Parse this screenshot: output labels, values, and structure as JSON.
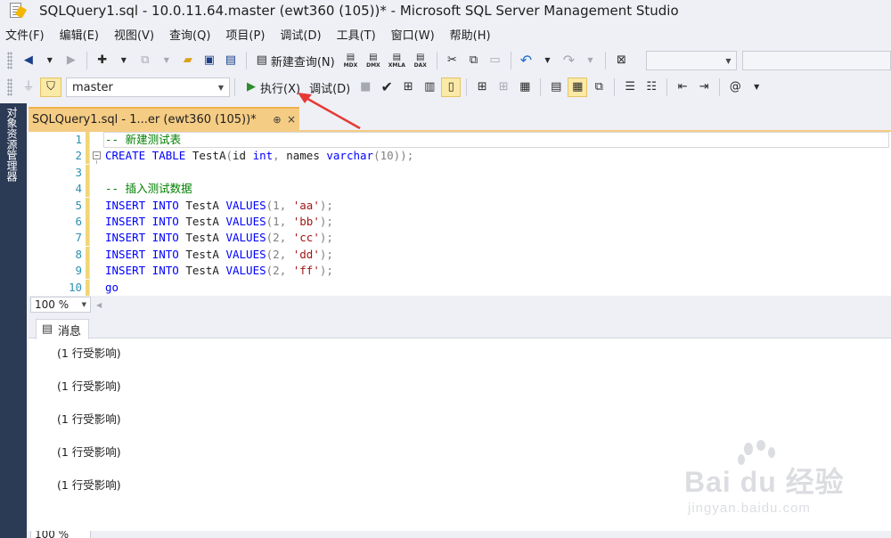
{
  "window": {
    "title": "SQLQuery1.sql - 10.0.11.64.master (ewt360 (105))* - Microsoft SQL Server Management Studio"
  },
  "menu": {
    "items": [
      "文件(F)",
      "编辑(E)",
      "视图(V)",
      "查询(Q)",
      "项目(P)",
      "调试(D)",
      "工具(T)",
      "窗口(W)",
      "帮助(H)"
    ]
  },
  "toolbar1": {
    "new_query_label": "新建查询(N)",
    "mdx_label": "MDX",
    "dmx_label": "DMX",
    "xmla_label": "XMLA",
    "dax_label": "DAX"
  },
  "toolbar2": {
    "database": "master",
    "execute_label": "执行(X)",
    "debug_label": "调试(D)"
  },
  "sidebar": {
    "label": "对象资源管理器"
  },
  "tab": {
    "title": "SQLQuery1.sql - 1...er (ewt360 (105))*",
    "pin_glyph": "⊕",
    "close_glyph": "×"
  },
  "editor": {
    "lines": [
      {
        "n": "1",
        "tokens": [
          {
            "t": "-- 新建测试表",
            "c": "cm"
          }
        ]
      },
      {
        "n": "2",
        "tokens": [
          {
            "t": "CREATE TABLE",
            "c": "kw"
          },
          {
            "t": " TestA",
            "c": ""
          },
          {
            "t": "(",
            "c": "gr"
          },
          {
            "t": "id ",
            "c": ""
          },
          {
            "t": "int",
            "c": "kw"
          },
          {
            "t": ", ",
            "c": "gr"
          },
          {
            "t": "names ",
            "c": ""
          },
          {
            "t": "varchar",
            "c": "kw"
          },
          {
            "t": "(10));",
            "c": "gr"
          }
        ]
      },
      {
        "n": "3",
        "tokens": []
      },
      {
        "n": "4",
        "tokens": [
          {
            "t": "-- 插入测试数据",
            "c": "cm"
          }
        ]
      },
      {
        "n": "5",
        "tokens": [
          {
            "t": "INSERT INTO",
            "c": "kw"
          },
          {
            "t": " TestA ",
            "c": ""
          },
          {
            "t": "VALUES",
            "c": "kw"
          },
          {
            "t": "(1, ",
            "c": "gr"
          },
          {
            "t": "'aa'",
            "c": "st"
          },
          {
            "t": ");",
            "c": "gr"
          }
        ]
      },
      {
        "n": "6",
        "tokens": [
          {
            "t": "INSERT INTO",
            "c": "kw"
          },
          {
            "t": " TestA ",
            "c": ""
          },
          {
            "t": "VALUES",
            "c": "kw"
          },
          {
            "t": "(1, ",
            "c": "gr"
          },
          {
            "t": "'bb'",
            "c": "st"
          },
          {
            "t": ");",
            "c": "gr"
          }
        ]
      },
      {
        "n": "7",
        "tokens": [
          {
            "t": "INSERT INTO",
            "c": "kw"
          },
          {
            "t": " TestA ",
            "c": ""
          },
          {
            "t": "VALUES",
            "c": "kw"
          },
          {
            "t": "(2, ",
            "c": "gr"
          },
          {
            "t": "'cc'",
            "c": "st"
          },
          {
            "t": ");",
            "c": "gr"
          }
        ]
      },
      {
        "n": "8",
        "tokens": [
          {
            "t": "INSERT INTO",
            "c": "kw"
          },
          {
            "t": " TestA ",
            "c": ""
          },
          {
            "t": "VALUES",
            "c": "kw"
          },
          {
            "t": "(2, ",
            "c": "gr"
          },
          {
            "t": "'dd'",
            "c": "st"
          },
          {
            "t": ");",
            "c": "gr"
          }
        ]
      },
      {
        "n": "9",
        "tokens": [
          {
            "t": "INSERT INTO",
            "c": "kw"
          },
          {
            "t": " TestA ",
            "c": ""
          },
          {
            "t": "VALUES",
            "c": "kw"
          },
          {
            "t": "(2, ",
            "c": "gr"
          },
          {
            "t": "'ff'",
            "c": "st"
          },
          {
            "t": ");",
            "c": "gr"
          }
        ]
      },
      {
        "n": "10",
        "tokens": [
          {
            "t": "go",
            "c": "kw"
          }
        ]
      }
    ]
  },
  "zoom": {
    "value": "100 %"
  },
  "results": {
    "tab_label": "消息",
    "messages": [
      "(1 行受影响)",
      "(1 行受影响)",
      "(1 行受影响)",
      "(1 行受影响)",
      "(1 行受影响)"
    ]
  },
  "watermark": {
    "brand": "Bai du 经验",
    "site": "jingyan.baidu.com"
  },
  "colors": {
    "keyword": "#0000ff",
    "comment": "#008000",
    "string": "#a31515",
    "line_number": "#2b91af",
    "tab_active": "#f5cc84",
    "sidebar": "#2b3a55",
    "annotation": "#e53935"
  },
  "icons": {
    "execute": "play-icon",
    "parse": "checkmark-icon",
    "stop": "stop-icon"
  }
}
